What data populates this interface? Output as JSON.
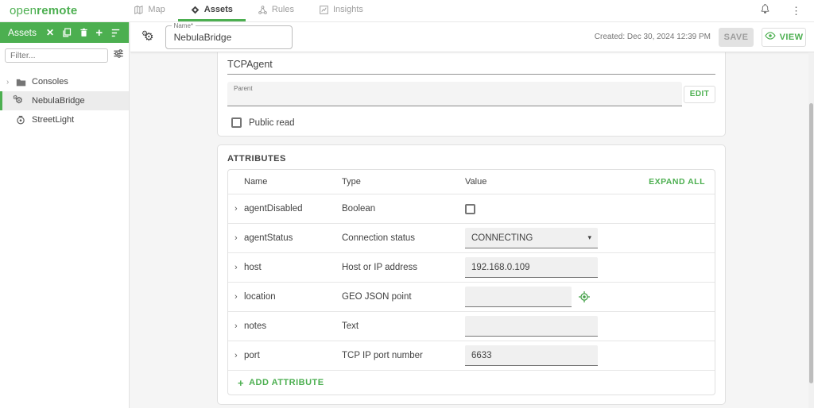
{
  "colors": {
    "accent": "#4caf50",
    "toolbar_green": "#4caf50"
  },
  "app_bar": {
    "logo_open": "open",
    "logo_remote": "remote",
    "tabs": [
      {
        "label": "Map",
        "icon": "map-icon",
        "active": false
      },
      {
        "label": "Assets",
        "icon": "assets-icon",
        "active": true
      },
      {
        "label": "Rules",
        "icon": "rules-icon",
        "active": false
      },
      {
        "label": "Insights",
        "icon": "insights-icon",
        "active": false
      }
    ]
  },
  "sidebar": {
    "title": "Assets",
    "filter_placeholder": "Filter...",
    "tree": [
      {
        "label": "Consoles",
        "icon": "folder-icon",
        "expandable": true,
        "selected": false
      },
      {
        "label": "NebulaBridge",
        "icon": "agent-cogs-icon",
        "expandable": false,
        "selected": true
      },
      {
        "label": "StreetLight",
        "icon": "streetlight-icon",
        "expandable": false,
        "selected": false
      }
    ]
  },
  "header": {
    "name_label": "Name*",
    "name_value": "NebulaBridge",
    "created_text": "Created: Dec 30, 2024 12:39 PM",
    "save_label": "SAVE",
    "view_label": "VIEW"
  },
  "info_panel": {
    "agent_type": "TCPAgent",
    "parent_label": "Parent",
    "edit_label": "EDIT",
    "public_read_label": "Public read",
    "public_read_checked": false
  },
  "attributes_panel": {
    "title": "ATTRIBUTES",
    "columns": {
      "name": "Name",
      "type": "Type",
      "value": "Value"
    },
    "expand_all_label": "EXPAND ALL",
    "add_attribute_label": "ADD ATTRIBUTE",
    "rows": [
      {
        "name": "agentDisabled",
        "type": "Boolean",
        "control": "checkbox",
        "value": "",
        "checked": false
      },
      {
        "name": "agentStatus",
        "type": "Connection status",
        "control": "select",
        "value": "CONNECTING"
      },
      {
        "name": "host",
        "type": "Host or IP address",
        "control": "text",
        "value": "192.168.0.109"
      },
      {
        "name": "location",
        "type": "GEO JSON point",
        "control": "geo",
        "value": ""
      },
      {
        "name": "notes",
        "type": "Text",
        "control": "text",
        "value": ""
      },
      {
        "name": "port",
        "type": "TCP IP port number",
        "control": "text",
        "value": "6633"
      }
    ]
  }
}
